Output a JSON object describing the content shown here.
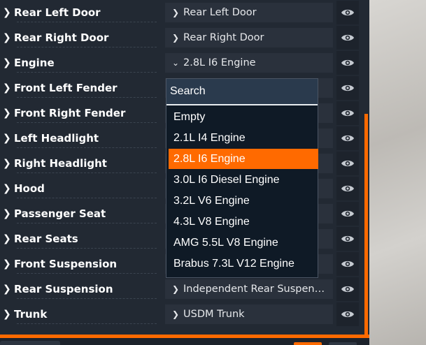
{
  "rows": [
    {
      "label": "Rear Left Door",
      "value": "Rear Left Door",
      "expanded": false
    },
    {
      "label": "Rear Right Door",
      "value": "Rear Right Door",
      "expanded": false
    },
    {
      "label": "Engine",
      "value": "2.8L I6 Engine",
      "expanded": true
    },
    {
      "label": "Front Left Fender",
      "value": "",
      "expanded": false
    },
    {
      "label": "Front Right Fender",
      "value": "",
      "expanded": false
    },
    {
      "label": "Left Headlight",
      "value": "",
      "expanded": false
    },
    {
      "label": "Right Headlight",
      "value": "",
      "expanded": false
    },
    {
      "label": "Hood",
      "value": "",
      "expanded": false
    },
    {
      "label": "Passenger Seat",
      "value": "",
      "expanded": false
    },
    {
      "label": "Rear Seats",
      "value": "",
      "expanded": false
    },
    {
      "label": "Front Suspension",
      "value": "",
      "expanded": false
    },
    {
      "label": "Rear Suspension",
      "value": "Independent Rear Suspen…",
      "expanded": false
    },
    {
      "label": "Trunk",
      "value": "USDM Trunk",
      "expanded": false
    }
  ],
  "dropdown": {
    "search_placeholder": "Search",
    "options": [
      "Empty",
      "2.1L I4 Engine",
      "2.8L I6 Engine",
      "3.0L I6 Diesel Engine",
      "3.2L V6 Engine",
      "4.3L V8 Engine",
      "AMG 5.5L V8 Engine",
      "Brabus 7.3L V12 Engine"
    ],
    "selected_index": 2
  },
  "colors": {
    "accent": "#ff6a00",
    "panel": "#222933",
    "dropdown_bg": "#0f1a26"
  },
  "icons": {
    "row_expand": "chevron-right-icon",
    "row_collapse": "chevron-down-icon",
    "visibility": "eye-icon"
  }
}
